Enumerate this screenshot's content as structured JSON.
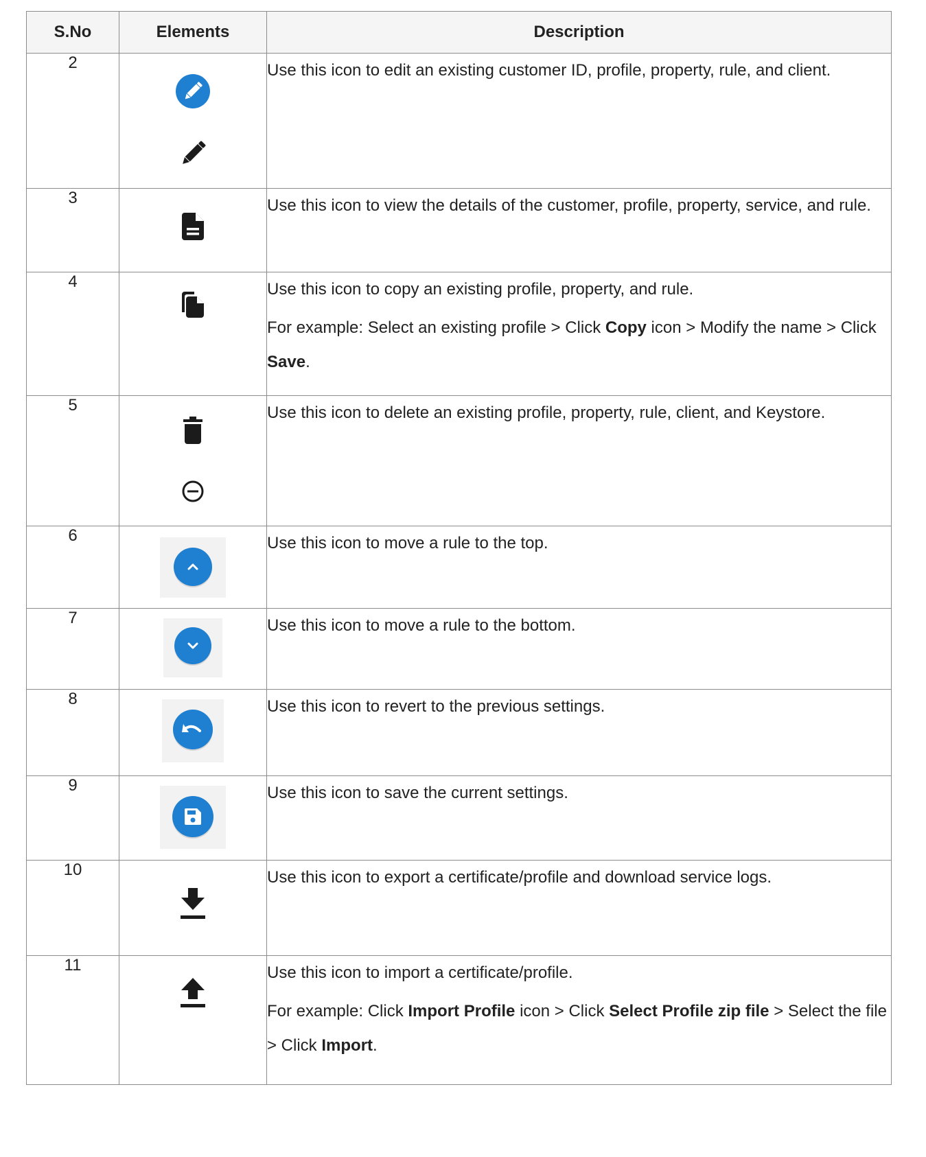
{
  "table": {
    "headers": [
      "S.No",
      "Elements",
      "Description"
    ],
    "rows": [
      {
        "sno": "2",
        "icons": [
          "edit-circle-icon",
          "pencil-icon"
        ],
        "desc": [
          [
            {
              "t": "Use this icon to edit an existing customer ID, profile, property, rule, and client."
            }
          ]
        ]
      },
      {
        "sno": "3",
        "icons": [
          "document-icon"
        ],
        "desc": [
          [
            {
              "t": "Use this icon to view the details of the customer, profile, property, service, and rule."
            }
          ]
        ]
      },
      {
        "sno": "4",
        "icons": [
          "copy-icon"
        ],
        "desc": [
          [
            {
              "t": "Use this icon to copy an existing profile, property, and rule."
            }
          ],
          [
            {
              "t": "For example: Select an existing profile > Click "
            },
            {
              "t": "Copy",
              "b": true
            },
            {
              "t": " icon > Modify the name > Click "
            },
            {
              "t": "Save",
              "b": true
            },
            {
              "t": "."
            }
          ]
        ]
      },
      {
        "sno": "5",
        "icons": [
          "trash-icon",
          "minus-circle-icon"
        ],
        "desc": [
          [
            {
              "t": "Use this icon to delete an existing profile, property, rule, client, and Keystore."
            }
          ]
        ]
      },
      {
        "sno": "6",
        "icons": [
          "chevron-up-circle-icon"
        ],
        "desc": [
          [
            {
              "t": "Use this icon to move a rule to the top."
            }
          ]
        ]
      },
      {
        "sno": "7",
        "icons": [
          "chevron-down-circle-icon"
        ],
        "desc": [
          [
            {
              "t": "Use this icon to move a rule to the bottom."
            }
          ]
        ]
      },
      {
        "sno": "8",
        "icons": [
          "undo-circle-icon"
        ],
        "desc": [
          [
            {
              "t": "Use this icon to revert to the previous settings."
            }
          ]
        ]
      },
      {
        "sno": "9",
        "icons": [
          "save-circle-icon"
        ],
        "desc": [
          [
            {
              "t": "Use this icon to save the current settings."
            }
          ]
        ]
      },
      {
        "sno": "10",
        "icons": [
          "download-icon"
        ],
        "desc": [
          [
            {
              "t": "Use this icon to export a certificate/profile and download service logs."
            }
          ]
        ]
      },
      {
        "sno": "11",
        "icons": [
          "upload-icon"
        ],
        "desc": [
          [
            {
              "t": "Use this icon to import a certificate/profile."
            }
          ],
          [
            {
              "t": "For example: Click "
            },
            {
              "t": "Import Profile",
              "b": true
            },
            {
              "t": " icon > Click "
            },
            {
              "t": "Select Profile zip file",
              "b": true
            },
            {
              "t": " > Select the file > Click "
            },
            {
              "t": "Import",
              "b": true
            },
            {
              "t": "."
            }
          ]
        ]
      }
    ]
  },
  "colors": {
    "accent_blue": "#1f7fd1",
    "icon_dark": "#1b1b1b",
    "border": "#8c8c8c"
  }
}
